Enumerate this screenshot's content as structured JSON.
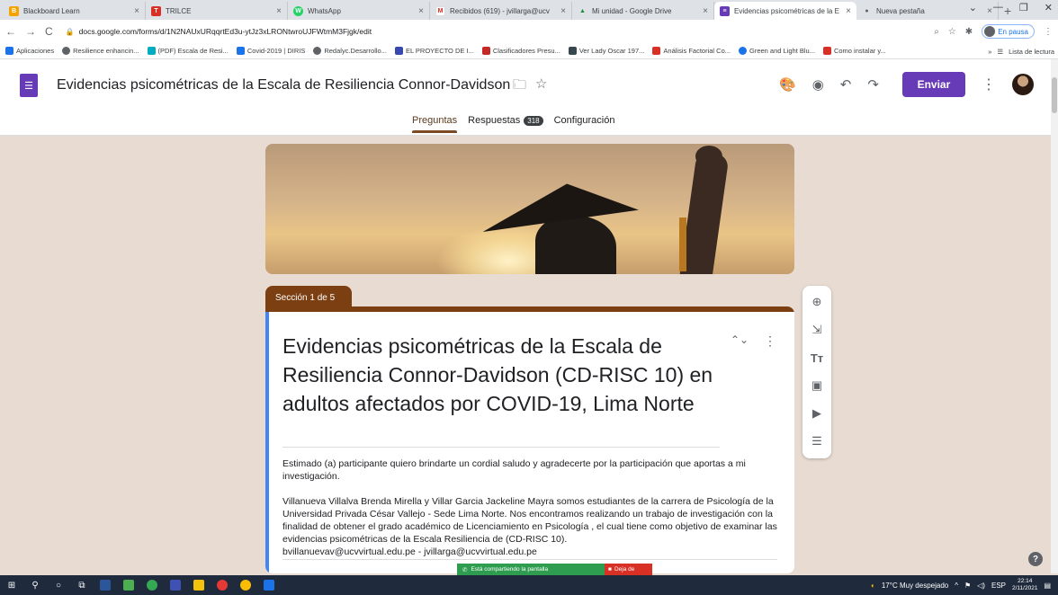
{
  "browser": {
    "tabs": [
      {
        "title": "Blackboard Learn",
        "color": "#f4a300",
        "glyph": "B"
      },
      {
        "title": "TRILCE",
        "color": "#d93025",
        "glyph": "T"
      },
      {
        "title": "WhatsApp",
        "color": "#25d366",
        "glyph": "W"
      },
      {
        "title": "Recibidos (619) - jvillarga@ucv",
        "color": "#ffffff",
        "glyph": "M"
      },
      {
        "title": "Mi unidad - Google Drive",
        "color": "#1a73e8",
        "glyph": "▲"
      },
      {
        "title": "Evidencias psicométricas de la E",
        "color": "#673ab7",
        "glyph": "≡"
      },
      {
        "title": "Nueva pestaña",
        "color": "#5f6368",
        "glyph": "●"
      }
    ],
    "url": "docs.google.com/forms/d/1N2NAUxURqqrtEd3u-ytJz3xLRONtwroUJFWtmM3Fjgk/edit",
    "profile_status": "En pausa",
    "bookmarks": [
      {
        "label": "Aplicaciones",
        "color": "#1a73e8"
      },
      {
        "label": "Resilience enhancin...",
        "color": "#5f6368"
      },
      {
        "label": "(PDF) Escala de Resi...",
        "color": "#00acc1"
      },
      {
        "label": "Covid-2019 | DIRIS",
        "color": "#1a73e8"
      },
      {
        "label": "Redalyc.Desarrollo...",
        "color": "#5f6368"
      },
      {
        "label": "EL PROYECTO DE I...",
        "color": "#3949ab"
      },
      {
        "label": "Clasificadores Presu...",
        "color": "#c62828"
      },
      {
        "label": "Ver Lady Oscar 197...",
        "color": "#37474f"
      },
      {
        "label": "Análisis Factorial Co...",
        "color": "#d93025"
      },
      {
        "label": "Green and Light Blu...",
        "color": "#1a73e8"
      },
      {
        "label": "Como instalar y...",
        "color": "#d93025"
      }
    ],
    "reading_list": "Lista de lectura"
  },
  "form_header": {
    "title": "Evidencias psicométricas de la Escala de Resiliencia Connor-Davidson (Cl",
    "send_label": "Enviar",
    "tabs": [
      {
        "label": "Preguntas"
      },
      {
        "label": "Respuestas",
        "count": "318"
      },
      {
        "label": "Configuración"
      }
    ]
  },
  "section": {
    "label": "Sección 1 de 5",
    "title": "Evidencias psicométricas de la Escala de Resiliencia Connor-Davidson (CD-RISC 10) en adultos afectados por COVID-19, Lima Norte",
    "description": "Estimado (a) participante quiero brindarte un cordial saludo y agradecerte por la participación que aportas a mi investigación.\n\nVillanueva Villalva Brenda Mirella y Villar Garcia Jackeline Mayra somos estudiantes de la carrera de Psicología de la Universidad Privada César Vallejo - Sede Lima Norte. Nos encontramos realizando un trabajo de investigación con la finalidad de obtener el grado académico de Licenciamiento en Psicología , el cual tiene como objetivo de examinar las evidencias psicométricas de la Escala Resiliencia de (CD-RISC 10).\nbvillanuevav@ucvvirtual.edu.pe - jvillarga@ucvvirtual.edu.pe"
  },
  "sharing": {
    "message": "Está compartiendo la pantalla",
    "stop_label": "Deja de"
  },
  "taskbar": {
    "weather": "17°C  Muy despejado",
    "language": "ESP",
    "time": "22:14",
    "date": "2/11/2021"
  },
  "colors": {
    "forms_purple": "#673ab7",
    "theme_brown": "#7b3f12",
    "page_bg": "#e8dcd2",
    "accent_blue": "#4285f4"
  }
}
